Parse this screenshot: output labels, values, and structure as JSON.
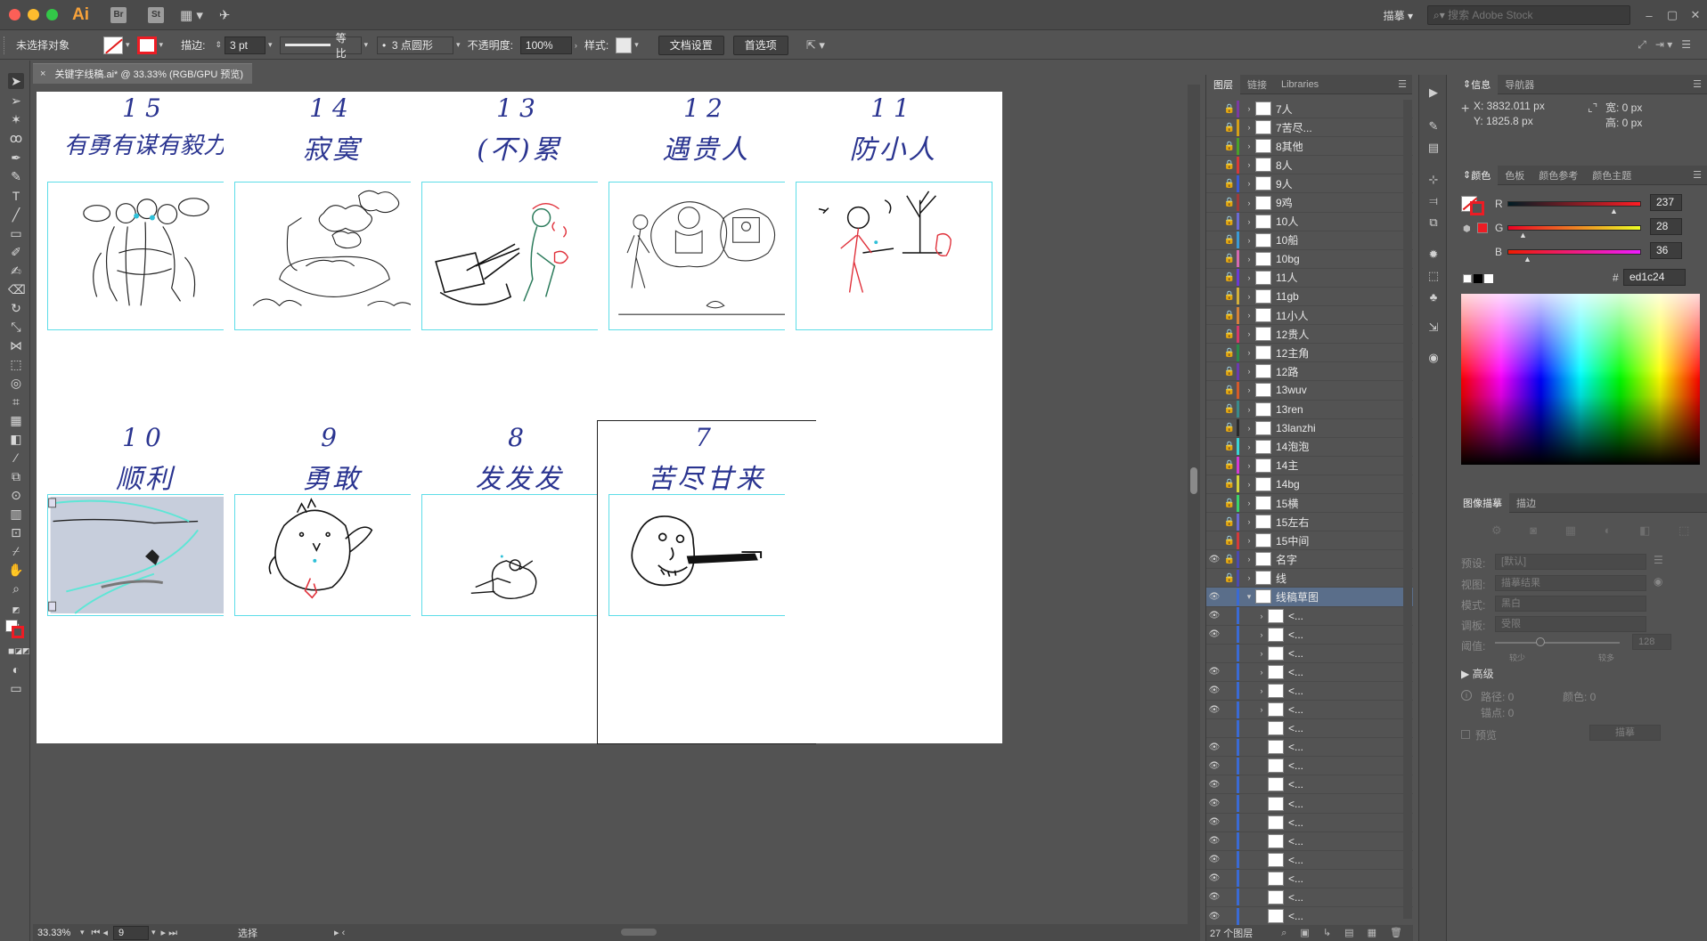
{
  "appbar": {
    "app_logo": "Ai",
    "bridge_badge": "Br",
    "stock_badge": "St",
    "workspace": "描摹",
    "stock_search_placeholder": "搜索 Adobe Stock"
  },
  "control": {
    "selection_label": "未选择对象",
    "stroke_label": "描边:",
    "stroke_weight": "3 pt",
    "profile_label": "等比",
    "brush_label": "3 点圆形",
    "opacity_label": "不透明度:",
    "opacity_value": "100%",
    "style_label": "样式:",
    "doc_setup_button": "文档设置",
    "prefs_button": "首选项"
  },
  "document": {
    "tab_title": "关键字线稿.ai* @ 33.33% (RGB/GPU 预览)",
    "close_symbol": "×"
  },
  "artboards": [
    {
      "number": "15",
      "title": "有勇有谋有毅力"
    },
    {
      "number": "14",
      "title": "寂寞"
    },
    {
      "number": "13",
      "title": "(不)累"
    },
    {
      "number": "12",
      "title": "遇贵人"
    },
    {
      "number": "11",
      "title": "防小人"
    },
    {
      "number": "10",
      "title": "顺利"
    },
    {
      "number": "9",
      "title": "勇敢"
    },
    {
      "number": "8",
      "title": "发发发"
    },
    {
      "number": "7",
      "title": "苦尽甘来"
    },
    {
      "number": "",
      "title": ""
    }
  ],
  "status": {
    "zoom": "33.33%",
    "artboard_number": "9",
    "tool_label": "选择"
  },
  "layers_panel": {
    "tabs": [
      "图层",
      "链接",
      "Libraries"
    ],
    "layers": [
      {
        "name": "7人",
        "color": "#7a3aa0",
        "visible": false,
        "locked": true
      },
      {
        "name": "7苦尽...",
        "color": "#d4a017",
        "visible": false,
        "locked": true
      },
      {
        "name": "8其他",
        "color": "#4aa02a",
        "visible": false,
        "locked": true
      },
      {
        "name": "8人",
        "color": "#d43a3a",
        "visible": false,
        "locked": true
      },
      {
        "name": "9人",
        "color": "#3a5ad4",
        "visible": false,
        "locked": true
      },
      {
        "name": "9鸡",
        "color": "#a03a3a",
        "visible": false,
        "locked": true
      },
      {
        "name": "10人",
        "color": "#6a6ad4",
        "visible": false,
        "locked": true
      },
      {
        "name": "10船",
        "color": "#3a9ad4",
        "visible": false,
        "locked": true
      },
      {
        "name": "10bg",
        "color": "#d46ab0",
        "visible": false,
        "locked": true
      },
      {
        "name": "11人",
        "color": "#6a3ad4",
        "visible": false,
        "locked": true
      },
      {
        "name": "11gb",
        "color": "#d4b03a",
        "visible": false,
        "locked": true
      },
      {
        "name": "11小人",
        "color": "#d4823a",
        "visible": false,
        "locked": true
      },
      {
        "name": "12贵人",
        "color": "#d43a6a",
        "visible": false,
        "locked": true
      },
      {
        "name": "12主角",
        "color": "#2a8a4a",
        "visible": false,
        "locked": true
      },
      {
        "name": "12路",
        "color": "#6a3ab0",
        "visible": false,
        "locked": true
      },
      {
        "name": "13wuv",
        "color": "#d45a2a",
        "visible": false,
        "locked": true
      },
      {
        "name": "13ren",
        "color": "#3a8a8a",
        "visible": false,
        "locked": true
      },
      {
        "name": "13lanzhi",
        "color": "#2a2a2a",
        "visible": false,
        "locked": true
      },
      {
        "name": "14泡泡",
        "color": "#3ad4d4",
        "visible": false,
        "locked": true
      },
      {
        "name": "14主",
        "color": "#d43ad4",
        "visible": false,
        "locked": true
      },
      {
        "name": "14bg",
        "color": "#d4d43a",
        "visible": false,
        "locked": true
      },
      {
        "name": "15横",
        "color": "#3ad46a",
        "visible": false,
        "locked": true
      },
      {
        "name": "15左右",
        "color": "#6a6ad4",
        "visible": false,
        "locked": true
      },
      {
        "name": "15中间",
        "color": "#d43a3a",
        "visible": false,
        "locked": true
      },
      {
        "name": "名字",
        "color": "#4a4ab0",
        "visible": true,
        "locked": true
      },
      {
        "name": "线",
        "color": "#4a4ab0",
        "visible": false,
        "locked": true
      },
      {
        "name": "线稿草图",
        "color": "#3a6ad4",
        "visible": true,
        "locked": false,
        "expanded": true
      }
    ],
    "sublayer_label": "<...",
    "sublayer_visibility": [
      true,
      true,
      false,
      true,
      true,
      true,
      false,
      true,
      true,
      true,
      true,
      true,
      true,
      true,
      true,
      true,
      true
    ],
    "footer": "27 个图层"
  },
  "info_panel": {
    "tabs": [
      "信息",
      "导航器"
    ],
    "x": "X: 3832.011 px",
    "y": "Y: 1825.8 px",
    "w": "宽: 0 px",
    "h": "高: 0 px"
  },
  "color_panel": {
    "tabs": [
      "颜色",
      "色板",
      "颜色参考",
      "颜色主题"
    ],
    "r_label": "R",
    "r_value": "237",
    "g_label": "G",
    "g_value": "28",
    "b_label": "B",
    "b_value": "36",
    "hash": "#",
    "hex": "ed1c24",
    "current_color": "#ed1c24"
  },
  "trace_panel": {
    "tabs": [
      "图像描摹",
      "描边"
    ],
    "preset_label": "预设:",
    "preset_value": "[默认]",
    "view_label": "视图:",
    "view_value": "描摹结果",
    "mode_label": "模式:",
    "mode_value": "黑白",
    "palette_label": "调板:",
    "palette_value": "受限",
    "threshold_label": "阈值:",
    "threshold_less": "较少",
    "threshold_more": "较多",
    "threshold_value": "128",
    "advanced": "高级",
    "paths_label": "路径: 0",
    "colors_label": "颜色: 0",
    "anchors_label": "锚点: 0",
    "preview_label": "预览",
    "trace_button": "描摹"
  }
}
